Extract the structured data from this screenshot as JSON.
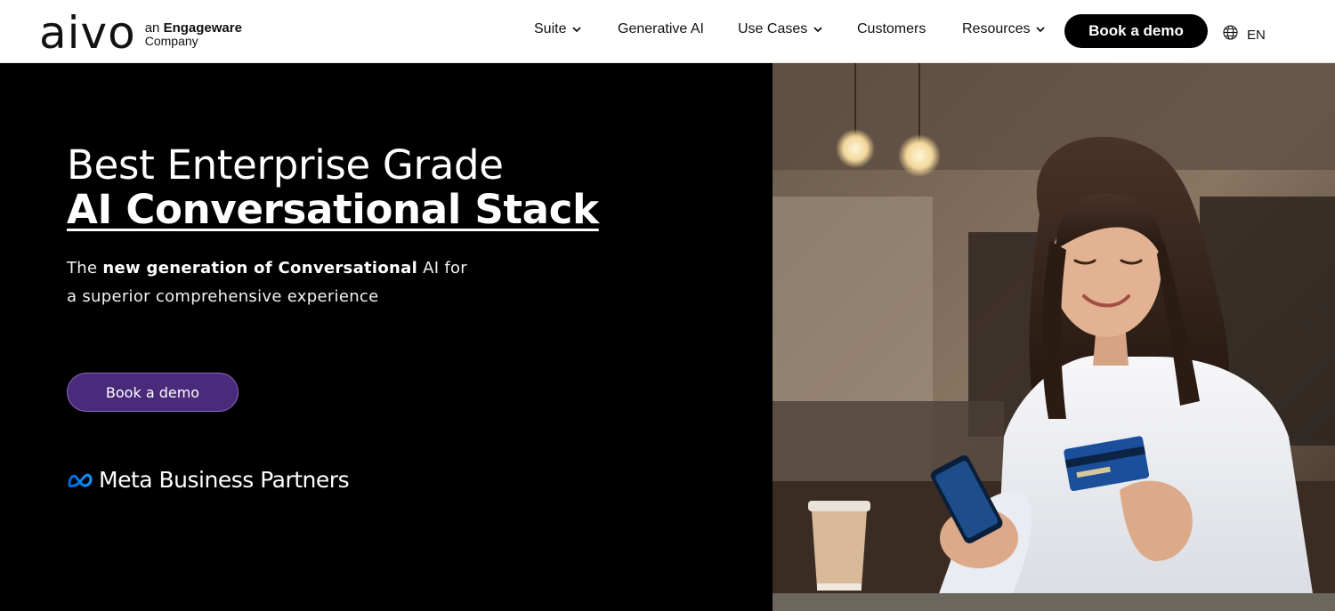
{
  "header": {
    "logo_word": "aivo",
    "logo_sub_prefix": "an",
    "logo_sub_brand": "Engageware",
    "logo_sub_line2": "Company",
    "nav": [
      {
        "label": "Suite",
        "has_dropdown": true
      },
      {
        "label": "Generative AI",
        "has_dropdown": false
      },
      {
        "label": "Use Cases",
        "has_dropdown": true
      },
      {
        "label": "Customers",
        "has_dropdown": false
      },
      {
        "label": "Resources",
        "has_dropdown": true
      }
    ],
    "cta_label": "Book a demo",
    "language": "EN"
  },
  "hero": {
    "title_line1": "Best Enterprise Grade",
    "title_line2": "AI Conversational Stack",
    "subtitle_part1": "The ",
    "subtitle_bold": "new generation of Conversational",
    "subtitle_part2": " AI for a superior comprehensive experience",
    "cta_label": "Book a demo",
    "partner_badge": "Meta Business Partners"
  },
  "colors": {
    "header_bg": "#ffffff",
    "hero_bg": "#000000",
    "hero_cta_bg": "#4a2a7a",
    "meta_blue": "#0a7cff"
  },
  "icons": [
    "chevron-down-icon",
    "globe-icon",
    "meta-logo-icon"
  ]
}
